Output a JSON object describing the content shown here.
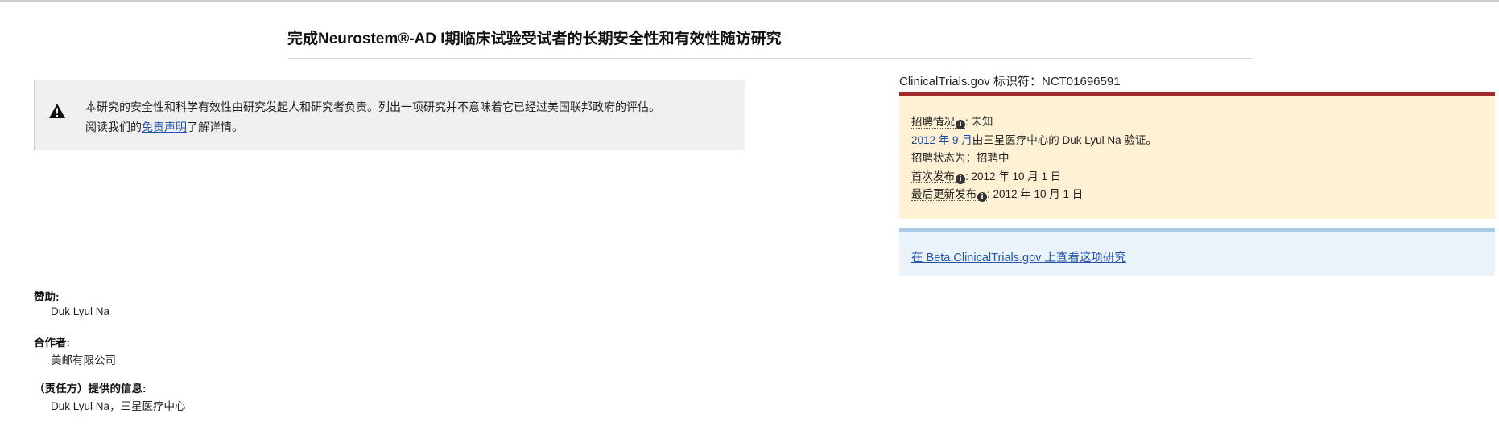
{
  "page": {
    "title": "完成Neurostem®-AD I期临床试验受试者的长期安全性和有效性随访研究"
  },
  "disclaimer": {
    "line1": "本研究的安全性和科学有效性由研究发起人和研究者负责。列出一项研究并不意味着它已经过美国联邦政府的评估。",
    "line2_prefix": "阅读我们的",
    "link_text": "免责声明",
    "line2_suffix": "了解详情。"
  },
  "identifier": {
    "label": "ClinicalTrials.gov 标识符：",
    "value": "NCT01696591"
  },
  "status": {
    "recruitment_label": "招聘情况",
    "recruitment_value": ": 未知",
    "verified_date": "2012 年 9 月",
    "verified_text": "由三星医疗中心的 Duk Lyul Na 验证。",
    "recruitment_status_text": "招聘状态为：招聘中",
    "first_posted_label": "首次发布",
    "first_posted_value": ": 2012 年 10 月 1 日",
    "last_update_label": "最后更新发布",
    "last_update_value": ": 2012 年 10 月 1 日",
    "info_glyph": "i"
  },
  "beta": {
    "link_text": "在 Beta.ClinicalTrials.gov 上查看这项研究"
  },
  "sponsor": {
    "label": "赞助:",
    "value": "Duk Lyul Na"
  },
  "collaborator": {
    "label": "合作者:",
    "value": "美邮有限公司"
  },
  "responsible_party": {
    "label": "（责任方）提供的信息:",
    "value": "Duk Lyul Na，三星医疗中心"
  },
  "colors": {
    "status_panel_bg": "#fff1d3",
    "status_panel_border": "#a12b2b",
    "beta_panel_bg": "#ebf3fa",
    "beta_panel_border": "#a8cbe8",
    "link": "#2255aa"
  },
  "icons": {
    "disclaimer": "warning-triangle-icon",
    "status_help": "info-circle-icon"
  }
}
